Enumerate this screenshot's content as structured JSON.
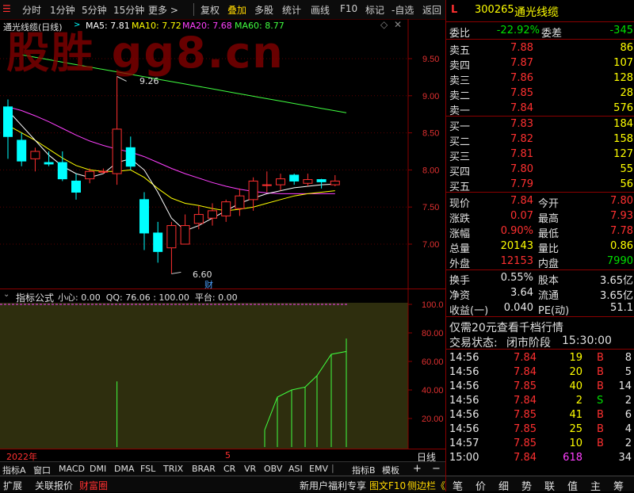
{
  "toolbar": {
    "left": [
      "分时",
      "1分钟",
      "5分钟",
      "15分钟",
      "更多 >"
    ],
    "right": [
      "复权",
      "叠加",
      "多股",
      "统计",
      "画线",
      "F10",
      "标记",
      "-自选",
      "返回"
    ],
    "selected": "叠加"
  },
  "watermark": "股胜 gg8.cn",
  "main_chart": {
    "title": "通光线缆(日线)",
    "ma": [
      {
        "label": "MA5: 7.81",
        "color": "#ffffff"
      },
      {
        "label": "MA10: 7.72",
        "color": "#ffff00"
      },
      {
        "label": "MA20: 7.68",
        "color": "#ff40ff"
      },
      {
        "label": "MA60: 8.77",
        "color": "#40ff40"
      }
    ],
    "high_label": "9.26",
    "low_label": "6.60",
    "cai_label": "财"
  },
  "sub_chart": {
    "title": "指标公式",
    "params": "小心: 0.00  QQ: 76.06 : 100.00  平台: 0.00",
    "xaxis": "日线",
    "date_labels": [
      "2022年",
      "5"
    ]
  },
  "chart_data": [
    {
      "type": "candlestick",
      "y_axis": [
        9.5,
        9.0,
        8.5,
        8.0,
        7.5,
        7.0
      ],
      "candles": [
        {
          "o": 8.85,
          "c": 8.45,
          "h": 8.95,
          "l": 8.15
        },
        {
          "o": 8.4,
          "c": 8.12,
          "h": 8.5,
          "l": 8.05
        },
        {
          "o": 8.15,
          "c": 8.25,
          "h": 8.3,
          "l": 7.98
        },
        {
          "o": 8.1,
          "c": 8.08,
          "h": 8.25,
          "l": 8.05
        },
        {
          "o": 8.1,
          "c": 7.88,
          "h": 8.25,
          "l": 7.85
        },
        {
          "o": 7.85,
          "c": 7.7,
          "h": 7.95,
          "l": 7.6
        },
        {
          "o": 7.88,
          "c": 7.98,
          "h": 8.02,
          "l": 7.82
        },
        {
          "o": 7.98,
          "c": 7.98,
          "h": 8.02,
          "l": 7.95
        },
        {
          "o": 7.95,
          "c": 8.55,
          "h": 9.26,
          "l": 7.8
        },
        {
          "o": 8.3,
          "c": 8.05,
          "h": 8.45,
          "l": 8.0
        },
        {
          "o": 7.6,
          "c": 7.15,
          "h": 7.7,
          "l": 6.92
        },
        {
          "o": 7.15,
          "c": 6.9,
          "h": 7.3,
          "l": 6.75
        },
        {
          "o": 6.95,
          "c": 7.25,
          "h": 7.3,
          "l": 6.6
        },
        {
          "o": 7.0,
          "c": 7.25,
          "h": 7.4,
          "l": 7.05
        },
        {
          "o": 7.28,
          "c": 7.4,
          "h": 7.52,
          "l": 7.2
        },
        {
          "o": 7.35,
          "c": 7.45,
          "h": 7.55,
          "l": 7.25
        },
        {
          "o": 7.38,
          "c": 7.57,
          "h": 7.6,
          "l": 7.3
        },
        {
          "o": 7.48,
          "c": 7.65,
          "h": 7.75,
          "l": 7.38
        },
        {
          "o": 7.6,
          "c": 7.85,
          "h": 7.9,
          "l": 7.45
        },
        {
          "o": 7.8,
          "c": 7.8,
          "h": 7.98,
          "l": 7.7
        },
        {
          "o": 7.8,
          "c": 7.88,
          "h": 7.95,
          "l": 7.72
        },
        {
          "o": 7.93,
          "c": 7.85,
          "h": 7.95,
          "l": 7.8
        },
        {
          "o": 7.82,
          "c": 7.87,
          "h": 7.95,
          "l": 7.78
        },
        {
          "o": 7.87,
          "c": 7.84,
          "h": 7.88,
          "l": 7.75
        },
        {
          "o": 7.8,
          "c": 7.85,
          "h": 7.93,
          "l": 7.78
        }
      ],
      "ma5": [
        8.8,
        8.6,
        8.4,
        8.2,
        8.05,
        7.95,
        7.9,
        7.95,
        8.1,
        8.15,
        8.0,
        7.7,
        7.35,
        7.18,
        7.25,
        7.35,
        7.45,
        7.55,
        7.62,
        7.68,
        7.72,
        7.76,
        7.78,
        7.8,
        7.81
      ],
      "ma10": [
        8.6,
        8.5,
        8.4,
        8.28,
        8.16,
        8.06,
        8.0,
        7.98,
        7.98,
        8.0,
        7.9,
        7.75,
        7.62,
        7.55,
        7.52,
        7.48,
        7.45,
        7.47,
        7.5,
        7.55,
        7.6,
        7.65,
        7.68,
        7.7,
        7.72
      ],
      "ma20": [
        8.85,
        8.8,
        8.73,
        8.65,
        8.56,
        8.47,
        8.39,
        8.33,
        8.28,
        8.24,
        8.18,
        8.1,
        8.02,
        7.95,
        7.89,
        7.83,
        7.78,
        7.74,
        7.71,
        7.69,
        7.68,
        7.68,
        7.68,
        7.68,
        7.68
      ],
      "ma60_start": 9.55,
      "ma60_end": 8.77
    },
    {
      "type": "area",
      "y_axis": [
        100.0,
        80.0,
        60.0,
        40.0,
        20.0
      ],
      "values": [
        0,
        0,
        0,
        0,
        0,
        0,
        0,
        0,
        0,
        0,
        0,
        0,
        0,
        0,
        0,
        0,
        0,
        0,
        0,
        0,
        0,
        12,
        35,
        40,
        42,
        50,
        65,
        67,
        76.06
      ],
      "spike_index": 8,
      "spike_value": 46
    }
  ],
  "indicator_tabs": [
    "指标A",
    "窗口",
    "MACD",
    "DMI",
    "DMA",
    "FSL",
    "TRIX",
    "BRAR",
    "CR",
    "VR",
    "OBV",
    "ASI",
    "EMV"
  ],
  "indicator_tabs_right": [
    "指标B",
    "模板",
    "+",
    "−"
  ],
  "bottom_left": [
    "扩展",
    "关联报价",
    "财富圈"
  ],
  "bottom_right": [
    "新用户福利专享",
    "图文F10",
    "侧边栏《"
  ],
  "quote": {
    "flag": "L",
    "code": "300265",
    "name": "通光线缆",
    "weibi_label": "委比",
    "weibi": "-22.92%",
    "weicha_label": "委差",
    "weicha": "-345",
    "asks": [
      {
        "label": "卖五",
        "price": "7.88",
        "vol": "86"
      },
      {
        "label": "卖四",
        "price": "7.87",
        "vol": "107"
      },
      {
        "label": "卖三",
        "price": "7.86",
        "vol": "128"
      },
      {
        "label": "卖二",
        "price": "7.85",
        "vol": "28"
      },
      {
        "label": "卖一",
        "price": "7.84",
        "vol": "576"
      }
    ],
    "bids": [
      {
        "label": "买一",
        "price": "7.83",
        "vol": "184"
      },
      {
        "label": "买二",
        "price": "7.82",
        "vol": "158"
      },
      {
        "label": "买三",
        "price": "7.81",
        "vol": "127"
      },
      {
        "label": "买四",
        "price": "7.80",
        "vol": "55"
      },
      {
        "label": "买五",
        "price": "7.79",
        "vol": "56"
      }
    ],
    "stats": [
      {
        "l1": "现价",
        "v1": "7.84",
        "l2": "今开",
        "v2": "7.80"
      },
      {
        "l1": "涨跌",
        "v1": "0.07",
        "l2": "最高",
        "v2": "7.93"
      },
      {
        "l1": "涨幅",
        "v1": "0.90%",
        "l2": "最低",
        "v2": "7.78"
      },
      {
        "l1": "总量",
        "v1": "20143",
        "l2": "量比",
        "v2": "0.86"
      },
      {
        "l1": "外盘",
        "v1": "12153",
        "l2": "内盘",
        "v2": "7990"
      }
    ],
    "stats2": [
      {
        "l1": "换手",
        "v1": "0.55%",
        "l2": "股本",
        "v2": "3.65亿"
      },
      {
        "l1": "净资",
        "v1": "3.64",
        "l2": "流通",
        "v2": "3.65亿"
      },
      {
        "l1": "收益(一)",
        "v1": "0.040",
        "l2": "PE(动)",
        "v2": "51.1"
      }
    ],
    "promo": "仅需20元查看千档行情",
    "status_label": "交易状态:",
    "status": "闭市阶段",
    "status_time": "15:30:00",
    "ticks": [
      {
        "t": "14:56",
        "p": "7.84",
        "v": "19",
        "d": "B",
        "n": "8"
      },
      {
        "t": "14:56",
        "p": "7.84",
        "v": "20",
        "d": "B",
        "n": "5"
      },
      {
        "t": "14:56",
        "p": "7.85",
        "v": "40",
        "d": "B",
        "n": "14"
      },
      {
        "t": "14:56",
        "p": "7.84",
        "v": "2",
        "d": "S",
        "n": "2"
      },
      {
        "t": "14:56",
        "p": "7.85",
        "v": "41",
        "d": "B",
        "n": "6"
      },
      {
        "t": "14:56",
        "p": "7.85",
        "v": "25",
        "d": "B",
        "n": "4"
      },
      {
        "t": "14:57",
        "p": "7.85",
        "v": "10",
        "d": "B",
        "n": "2"
      },
      {
        "t": "15:00",
        "p": "7.84",
        "v": "618",
        "d": "",
        "n": "34"
      }
    ],
    "bottom_tabs": [
      "笔",
      "价",
      "细",
      "势",
      "联",
      "值",
      "主",
      "筹"
    ]
  }
}
